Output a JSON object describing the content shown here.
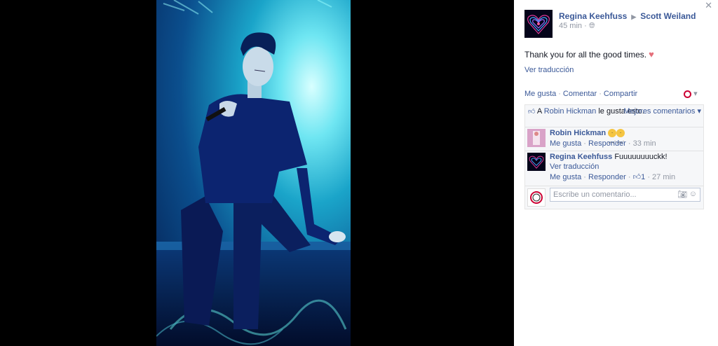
{
  "post": {
    "author": "Regina Keehfuss",
    "target": "Scott Weiland",
    "time": "45 min",
    "text": "Thank you for all the good times.",
    "translate_label": "Ver traducción"
  },
  "actions": {
    "like": "Me gusta",
    "comment": "Comentar",
    "share": "Compartir"
  },
  "feedback": {
    "likes_prefix": "A",
    "likes_name": "Robin Hickman",
    "likes_suffix": "le gusta esto.",
    "sort_label": "Mejores comentarios"
  },
  "comments": [
    {
      "author": "Robin Hickman",
      "text": "",
      "like_label": "Me gusta",
      "reply_label": "Responder",
      "time": "33 min"
    },
    {
      "author": "Regina Keehfuss",
      "text": "Fuuuuuuuuckk!",
      "translate_label": "Ver traducción",
      "like_label": "Me gusta",
      "reply_label": "Responder",
      "like_count": "1",
      "time": "27 min"
    }
  ],
  "composer": {
    "placeholder": "Escribe un comentario..."
  },
  "icons": {
    "close": "close-icon",
    "audience": "globe-icon",
    "heart": "heart-icon",
    "camera": "camera-icon",
    "emoji": "emoji-icon"
  },
  "colors": {
    "link": "#3b5998",
    "meta": "#9197a3",
    "photo_glow": "#6fe6f2"
  }
}
